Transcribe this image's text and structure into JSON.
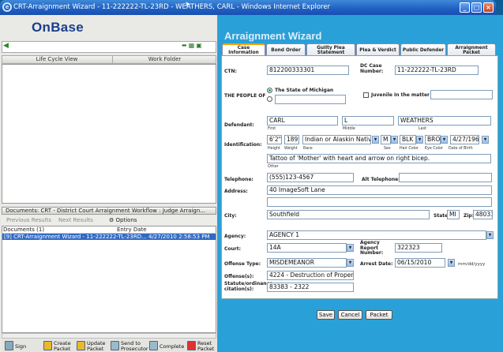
{
  "window": {
    "title": "CRT-Arraignment Wizard - 11-222222-TL-23RD - WEATHERS, CARL - Windows Internet Explorer",
    "min": "_",
    "max": "□",
    "close": "×"
  },
  "left": {
    "logo": "OnBase",
    "tabs": {
      "lifecycle": "Life Cycle View",
      "workfolder": "Work Folder"
    },
    "docs_header": "Documents: CRT - District Court Arraignment Workflow : Judge Arraign...",
    "nav": {
      "prev": "Previous Results",
      "next": "Next Results",
      "options": "Options"
    },
    "table": {
      "col1": "Documents (1)",
      "col2": "Entry Date",
      "row": "[9] CRT-Arraignment Wizard - 11-222222-TL-23RD... 4/27/2010 2:58:53 PM"
    },
    "bottom": [
      "Sign",
      "Create Packet",
      "Update Packet",
      "Send to Prosecutor",
      "Complete",
      "Reset Packet"
    ]
  },
  "wizard": {
    "title": "Arraignment Wizard",
    "tabs": [
      "Case Information",
      "Bond Order",
      "Guilty Plea Statement",
      "Plea & Verdict",
      "Public Defender",
      "Arraignment Packet"
    ],
    "ctn_label": "CTN:",
    "ctn": "812200333301",
    "dc_label": "DC Case Number:",
    "dc": "11-222222-TL-23RD",
    "people_label": "THE PEOPLE OF",
    "state_option": "The State of Michigan",
    "juvenile": "Juvenile In the matter of",
    "defendant_label": "Defendant:",
    "first": "CARL",
    "middle": "L",
    "last": "WEATHERS",
    "first_lbl": "First",
    "middle_lbl": "Middle",
    "last_lbl": "Last",
    "ident_label": "Identification:",
    "height": "6'2\"",
    "weight": "189",
    "race": "Indian or Alaskin Native",
    "sex": "M",
    "hair": "BLK",
    "eye": "BRO",
    "dob": "4/27/1968",
    "id_sub": {
      "height": "Height",
      "weight": "Weight",
      "race": "Race",
      "sex": "Sex",
      "hair": "Hair Color",
      "eye": "Eye Color",
      "dob": "Date of Birth"
    },
    "other": "Tattoo of 'Mother' with heart and arrow on right bicep.",
    "other_lbl": "Other",
    "tel_label": "Telephone:",
    "telephone": "(555)123-4567",
    "alt_tel_label": "Alt Telephone:",
    "address_label": "Address:",
    "address": "40 ImageSoft Lane",
    "city_label": "City:",
    "city": "Southfield",
    "state_label": "State:",
    "state": "MI",
    "zip_label": "Zip:",
    "zip": "48033",
    "agency_label": "Agency:",
    "agency": "AGENCY 1",
    "court_label": "Court:",
    "court": "14A",
    "agency_report_label": "Agency Report Number:",
    "agency_report": "322323",
    "offense_type_label": "Offense Type:",
    "offense_type": "MISDEMEANOR",
    "arrest_label": "Arrest Date:",
    "arrest_date": "06/15/2010",
    "date_fmt": "mm/dd/yyyy",
    "offenses_label": "Offense(s):",
    "offenses": "4224 - Destruction of Property",
    "statute_label": "Statute/ordinance citation(s):",
    "statute": "83383 - 2322"
  },
  "buttons": {
    "save": "Save",
    "cancel": "Cancel",
    "packet": "Packet"
  }
}
